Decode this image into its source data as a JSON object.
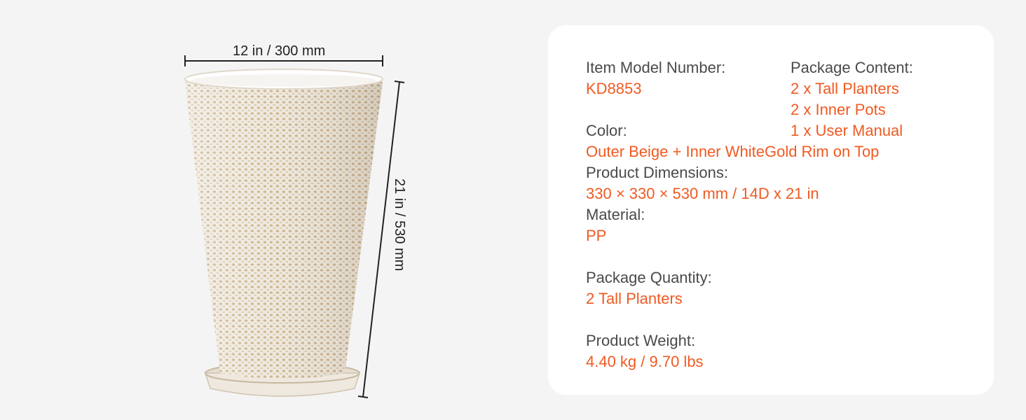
{
  "product": {
    "width_dimension": "12 in / 300 mm",
    "height_dimension": "21 in / 530 mm",
    "illustration_icon": "tall-textured-planter-icon"
  },
  "specs": {
    "model": {
      "label": "Item Model Number:",
      "value": "KD8853"
    },
    "package_content": {
      "label": "Package Content:",
      "items": [
        "2 x Tall Planters",
        "2 x Inner Pots",
        "1 x User Manual"
      ]
    },
    "color": {
      "label": "Color:",
      "value": "Outer Beige + Inner WhiteGold Rim on Top"
    },
    "dimensions": {
      "label": "Product Dimensions:",
      "value": "330 × 330 × 530 mm / 14D x 21 in"
    },
    "material": {
      "label": "Material:",
      "value": "PP"
    },
    "quantity": {
      "label": "Package Quantity:",
      "value": "2 Tall Planters"
    },
    "weight": {
      "label": "Product Weight:",
      "value": "4.40 kg / 9.70 lbs"
    }
  },
  "colors": {
    "background": "#f4f4f4",
    "card": "#ffffff",
    "label_text": "#4a4a4a",
    "value_text": "#f05a22"
  }
}
